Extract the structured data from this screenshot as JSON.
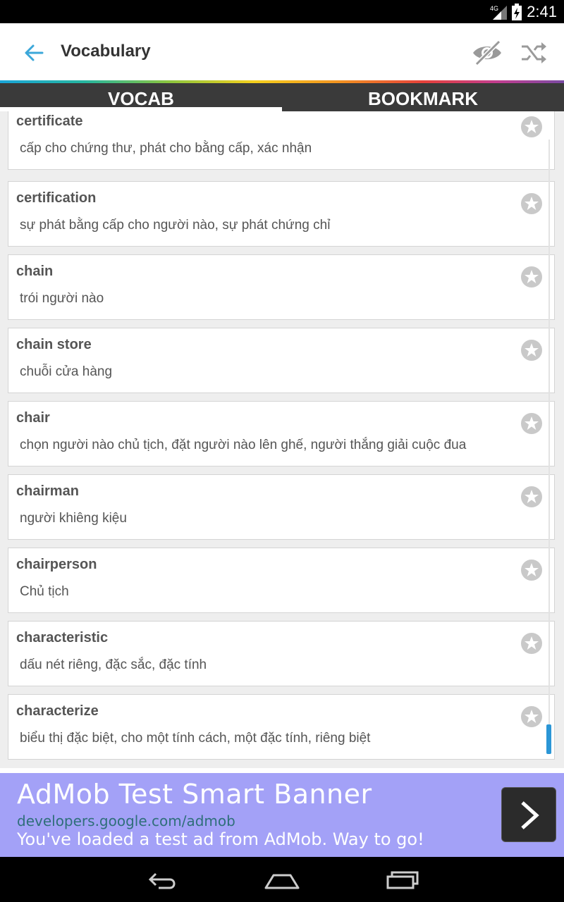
{
  "status_bar": {
    "network": "4G",
    "time": "2:41"
  },
  "action_bar": {
    "title": "Vocabulary",
    "back_icon": "arrow-left-icon",
    "eye_icon": "eye-off-icon",
    "shuffle_icon": "shuffle-icon",
    "accent_color": "#3ba7d9"
  },
  "tabs": [
    {
      "label": "VOCAB",
      "active": true
    },
    {
      "label": "BOOKMARK",
      "active": false
    }
  ],
  "words": [
    {
      "word": "certificate",
      "meaning": "cấp cho chứng thư, phát cho bằng cấp, xác nhận"
    },
    {
      "word": "certification",
      "meaning": "sự phát bằng cấp cho người nào, sự phát chứng chỉ"
    },
    {
      "word": "chain",
      "meaning": "trói người nào"
    },
    {
      "word": "chain store",
      "meaning": "chuỗi cửa hàng"
    },
    {
      "word": "chair",
      "meaning": "chọn người nào chủ tịch, đặt người nào lên ghế, người thắng giải cuộc đua"
    },
    {
      "word": "chairman",
      "meaning": "người khiêng kiệu"
    },
    {
      "word": "chairperson",
      "meaning": "Chủ tịch"
    },
    {
      "word": "characteristic",
      "meaning": "dấu nét riêng, đặc sắc, đặc tính"
    },
    {
      "word": "characterize",
      "meaning": "biểu thị đặc biệt, cho một tính cách, một đặc tính, riêng biệt"
    }
  ],
  "ad": {
    "title": "AdMob Test Smart Banner",
    "url": "developers.google.com/admob",
    "description": "You've loaded a test ad from AdMob. Way to go!",
    "background": "#a3a1f7"
  },
  "nav": {
    "back_icon": "nav-back-icon",
    "home_icon": "nav-home-icon",
    "recents_icon": "nav-recents-icon"
  }
}
